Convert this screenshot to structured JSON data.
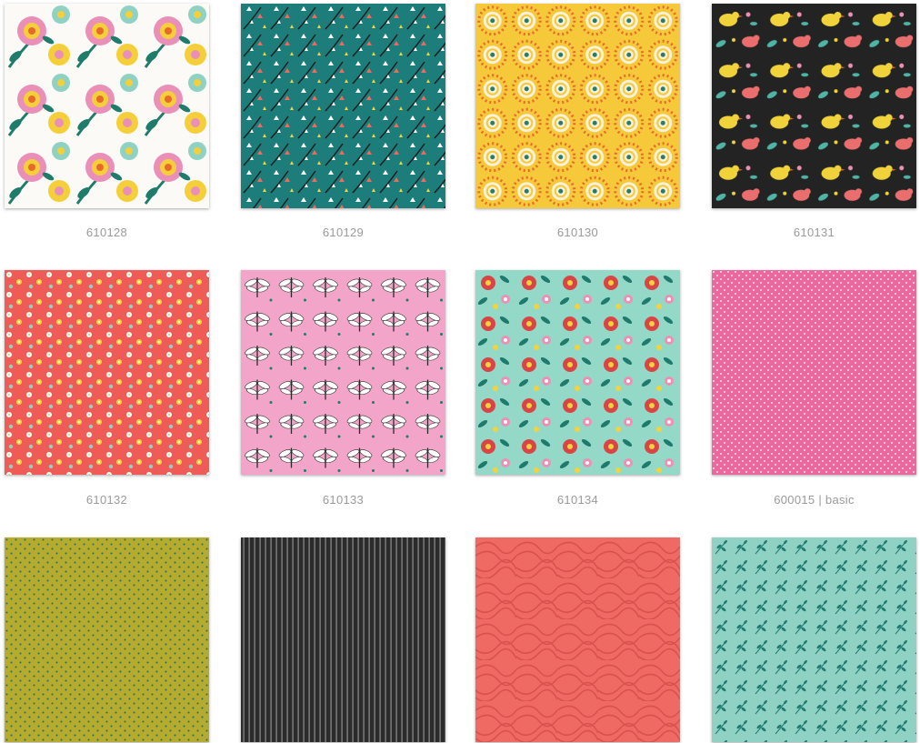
{
  "swatches": [
    {
      "label": "610128",
      "pattern": "white-floral",
      "bg": "#fbfaf6",
      "colors": [
        "#ea8fb8",
        "#f4cf3a",
        "#8fd2c4",
        "#1f7b6a"
      ]
    },
    {
      "label": "610129",
      "pattern": "teal-tulips",
      "bg": "#1c7d7a",
      "colors": [
        "#ffffff",
        "#ee6a5f",
        "#f6d33c",
        "#1d1d1d"
      ]
    },
    {
      "label": "610130",
      "pattern": "yellow-medallions",
      "bg": "#f6c93a",
      "colors": [
        "#e86a2a",
        "#f9f1d8",
        "#2a7b6c"
      ]
    },
    {
      "label": "610131",
      "pattern": "black-birds",
      "bg": "#232323",
      "colors": [
        "#f0d33b",
        "#ea6e6e",
        "#4fb3a6",
        "#ee8fb5"
      ]
    },
    {
      "label": "610132",
      "pattern": "coral-ditsy",
      "bg": "#ef5b57",
      "colors": [
        "#ffffff",
        "#f6d33c",
        "#8fd2c4"
      ]
    },
    {
      "label": "610133",
      "pattern": "pink-dragonflies",
      "bg": "#f2a5c8",
      "colors": [
        "#ffffff",
        "#2a2a2a",
        "#1e7a6c"
      ]
    },
    {
      "label": "610134",
      "pattern": "mint-floral",
      "bg": "#94d8c8",
      "colors": [
        "#d94444",
        "#1e7a6c",
        "#f3d23e",
        "#ee8fb5"
      ]
    },
    {
      "label": "600015 | basic",
      "pattern": "pink-dots",
      "bg": "#e9699f",
      "colors": [
        "#ffffff"
      ]
    },
    {
      "label": "",
      "pattern": "mustard-dots",
      "bg": "#b5ab2e",
      "colors": [
        "#1f6e66"
      ]
    },
    {
      "label": "",
      "pattern": "black-stripes",
      "bg": "#2b2b2b",
      "colors": [
        "#8f8f8f"
      ]
    },
    {
      "label": "",
      "pattern": "coral-swirl",
      "bg": "#ef6a62",
      "colors": [
        "#d8514c"
      ]
    },
    {
      "label": "",
      "pattern": "mint-leaves",
      "bg": "#8fd1c2",
      "colors": [
        "#1f7a72"
      ]
    }
  ]
}
